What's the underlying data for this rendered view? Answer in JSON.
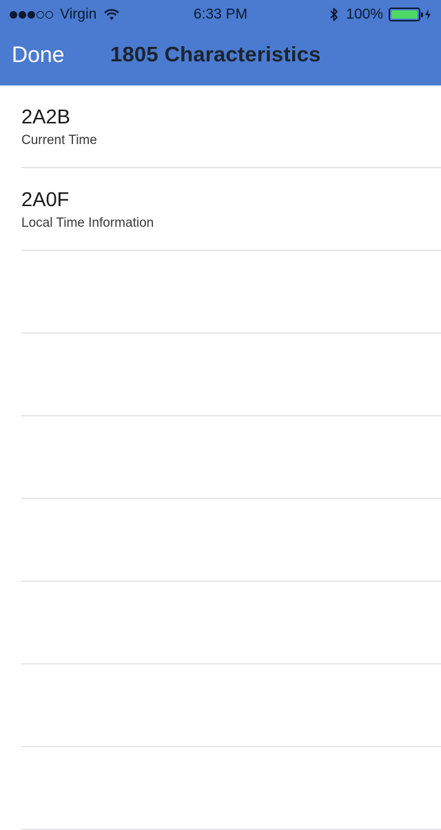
{
  "status_bar": {
    "signal_filled": 3,
    "signal_total": 5,
    "carrier": "Virgin",
    "time": "6:33 PM",
    "battery_percent": "100%",
    "battery_level": 1.0,
    "battery_color": "#4cd964",
    "icons": [
      "wifi-icon",
      "bluetooth-icon",
      "battery-icon",
      "charging-icon"
    ]
  },
  "nav": {
    "done_label": "Done",
    "title": "1805 Characteristics",
    "bar_color": "#4a7bd0"
  },
  "characteristics": [
    {
      "uuid": "2A2B",
      "name": "Current Time"
    },
    {
      "uuid": "2A0F",
      "name": "Local Time Information"
    }
  ],
  "empty_rows": 7
}
